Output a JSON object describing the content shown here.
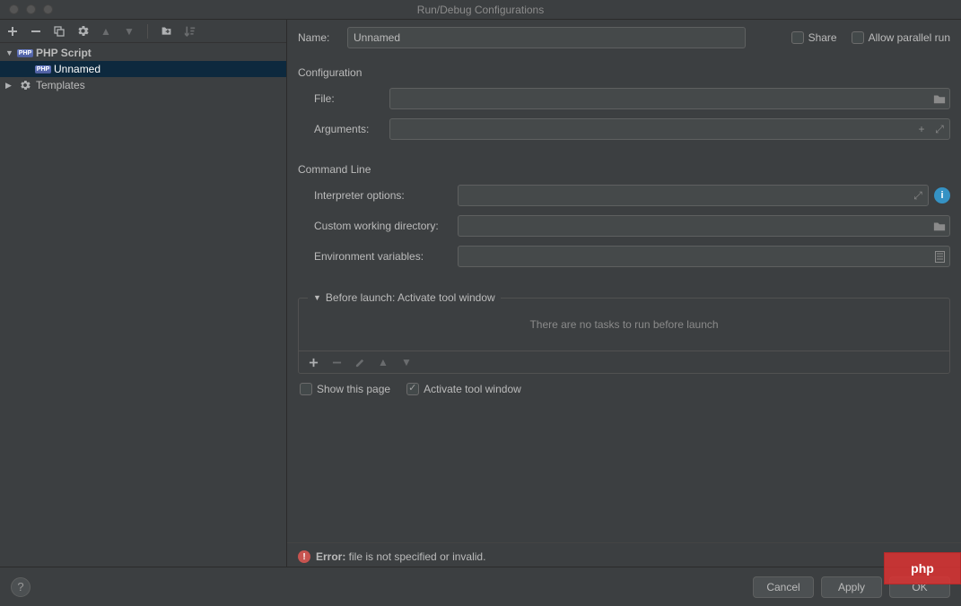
{
  "window": {
    "title": "Run/Debug Configurations"
  },
  "sidebar": {
    "tree": {
      "phpScript": {
        "label": "PHP Script"
      },
      "unnamed": {
        "label": "Unnamed"
      },
      "templates": {
        "label": "Templates"
      }
    }
  },
  "form": {
    "nameLabel": "Name:",
    "nameValue": "Unnamed",
    "shareLabel": "Share",
    "allowParallelLabel": "Allow parallel run",
    "config": {
      "title": "Configuration",
      "fileLabel": "File:",
      "fileValue": "",
      "argsLabel": "Arguments:",
      "argsValue": ""
    },
    "cmdline": {
      "title": "Command Line",
      "interpLabel": "Interpreter options:",
      "interpValue": "",
      "workdirLabel": "Custom working directory:",
      "workdirValue": "",
      "envLabel": "Environment variables:",
      "envValue": ""
    },
    "before": {
      "title": "Before launch: Activate tool window",
      "emptyMsg": "There are no tasks to run before launch",
      "showPageLabel": "Show this page",
      "activateLabel": "Activate tool window"
    },
    "error": {
      "label": "Error:",
      "message": " file is not specified or invalid."
    }
  },
  "footer": {
    "cancel": "Cancel",
    "apply": "Apply",
    "ok": "OK"
  },
  "watermark": "php"
}
